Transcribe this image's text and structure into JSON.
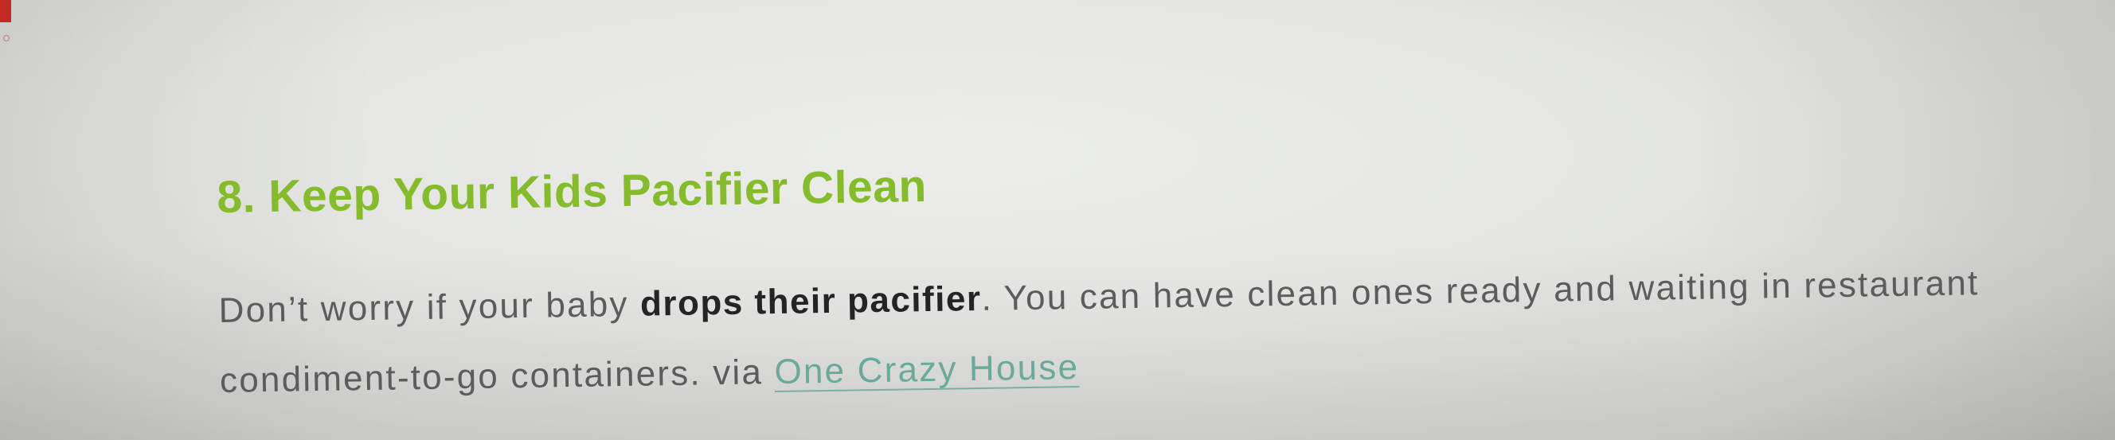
{
  "article": {
    "heading": "8. Keep Your Kids Pacifier Clean",
    "paragraph": {
      "text_before": "Don’t worry if your baby ",
      "bold_text": "drops their pacifier",
      "text_middle": ". You can have clean ones ready and waiting in restaurant condiment-to-go containers. via ",
      "link_text": "One Crazy House"
    }
  },
  "colors": {
    "heading": "#84bc2a",
    "body_text": "#5a5c5e",
    "bold_text": "#232425",
    "link": "#6aaa9a",
    "corner_marker": "#c42a24"
  }
}
